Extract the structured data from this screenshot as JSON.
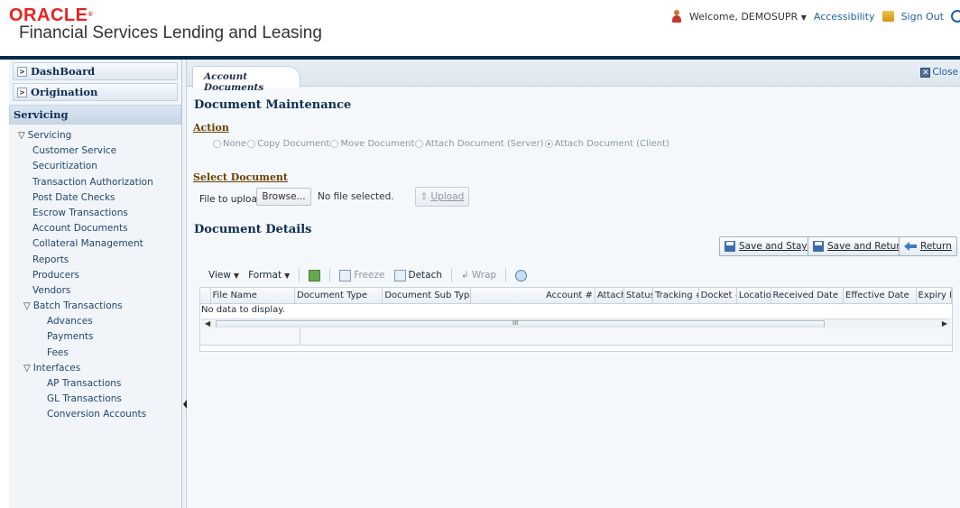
{
  "header": {
    "brand": "ORACLE",
    "app_title": "Financial Services Lending and Leasing",
    "welcome": "Welcome, DEMOSUPR",
    "accessibility": "Accessibility",
    "sign_out": "Sign Out"
  },
  "nav": {
    "dashboard": "DashBoard",
    "origination": "Origination",
    "servicing": "Servicing",
    "tree": [
      {
        "label": "Servicing",
        "level": 1,
        "expandable": true
      },
      {
        "label": "Customer Service",
        "level": 2
      },
      {
        "label": "Securitization",
        "level": 2
      },
      {
        "label": "Transaction Authorization",
        "level": 2
      },
      {
        "label": "Post Date Checks",
        "level": 2
      },
      {
        "label": "Escrow Transactions",
        "level": 2
      },
      {
        "label": "Account Documents",
        "level": 2
      },
      {
        "label": "Collateral Management",
        "level": 2
      },
      {
        "label": "Reports",
        "level": 2
      },
      {
        "label": "Producers",
        "level": 2
      },
      {
        "label": "Vendors",
        "level": 2
      },
      {
        "label": "Batch Transactions",
        "level": 1,
        "expandable": true,
        "indent": true
      },
      {
        "label": "Advances",
        "level": 3
      },
      {
        "label": "Payments",
        "level": 3
      },
      {
        "label": "Fees",
        "level": 3
      },
      {
        "label": "Interfaces",
        "level": 1,
        "expandable": true,
        "indent": true
      },
      {
        "label": "AP Transactions",
        "level": 3
      },
      {
        "label": "GL Transactions",
        "level": 3
      },
      {
        "label": "Conversion Accounts",
        "level": 3
      }
    ]
  },
  "tab": {
    "label": "Account Documents",
    "close": "Close"
  },
  "doc_maintenance": {
    "title": "Document Maintenance",
    "action_label": "Action",
    "options": [
      {
        "label": "None",
        "selected": false
      },
      {
        "label": "Copy Document",
        "selected": false
      },
      {
        "label": "Move Document",
        "selected": false
      },
      {
        "label": "Attach Document (Server)",
        "selected": false
      },
      {
        "label": "Attach Document (Client)",
        "selected": true
      }
    ],
    "select_doc_label": "Select Document",
    "file_to_upload": "File to upload",
    "browse": "Browse...",
    "no_file": "No file selected.",
    "upload": "Upload"
  },
  "doc_details": {
    "title": "Document Details",
    "save_and_stay": "Save and Stay",
    "save_and_return": "Save and Return",
    "return": "Return"
  },
  "toolbar": {
    "view": "View",
    "format": "Format",
    "freeze": "Freeze",
    "detach": "Detach",
    "wrap": "Wrap"
  },
  "grid": {
    "columns": [
      "File Name",
      "Document Type",
      "Document Sub Type",
      "Account #",
      "Attach",
      "Status",
      "Tracking #",
      "Docket #",
      "Location",
      "Received Date",
      "Effective Date",
      "Expiry Da"
    ],
    "empty": "No data to display."
  }
}
